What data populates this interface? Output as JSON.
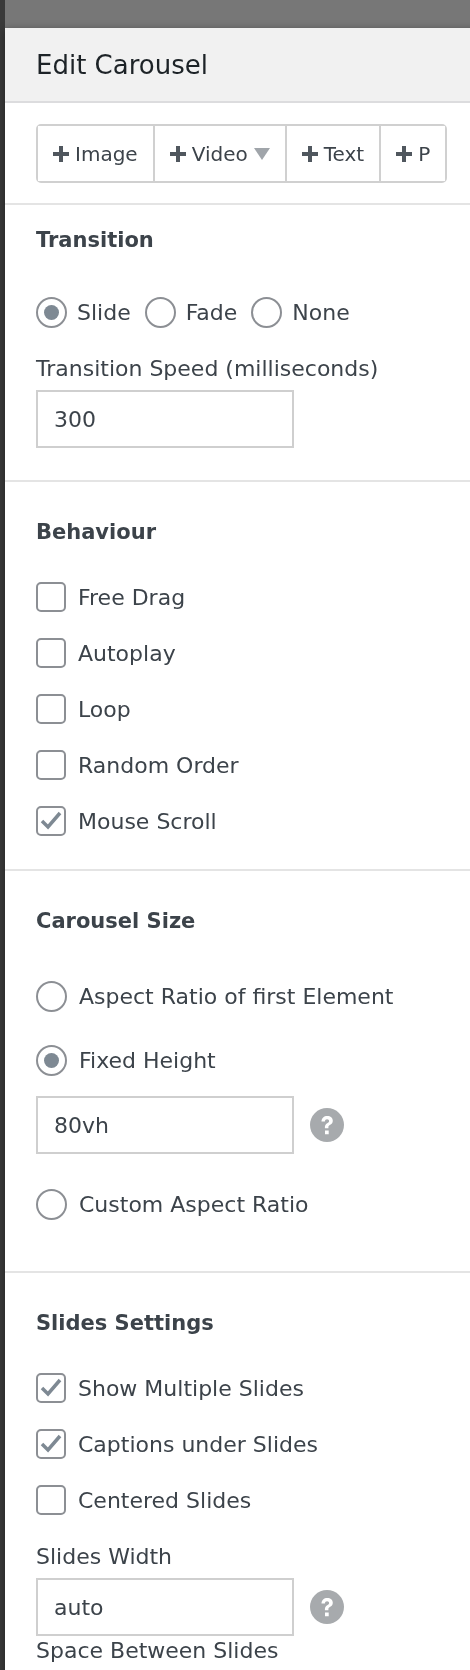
{
  "dialog": {
    "title": "Edit Carousel"
  },
  "toolbar": [
    {
      "label": "Image",
      "dropdown": false
    },
    {
      "label": "Video",
      "dropdown": true
    },
    {
      "label": "Text",
      "dropdown": false
    },
    {
      "label": "P",
      "dropdown": false
    }
  ],
  "sections": [
    {
      "heading": "Transition",
      "items": [
        {
          "kind": "radio_row",
          "options": [
            {
              "label": "Slide",
              "selected": true
            },
            {
              "label": "Fade",
              "selected": false
            },
            {
              "label": "None",
              "selected": false
            }
          ]
        },
        {
          "kind": "label",
          "text": "Transition Speed (milliseconds)"
        },
        {
          "kind": "field",
          "value": "300",
          "help": false
        }
      ]
    },
    {
      "heading": "Behaviour",
      "items": [
        {
          "kind": "checkbox",
          "label": "Free Drag",
          "checked": false
        },
        {
          "kind": "checkbox",
          "label": "Autoplay",
          "checked": false
        },
        {
          "kind": "checkbox",
          "label": "Loop",
          "checked": false
        },
        {
          "kind": "checkbox",
          "label": "Random Order",
          "checked": false
        },
        {
          "kind": "checkbox",
          "label": "Mouse Scroll",
          "checked": true
        }
      ]
    },
    {
      "heading": "Carousel Size",
      "items": [
        {
          "kind": "radio",
          "label": "Aspect Ratio of first Element",
          "selected": false
        },
        {
          "kind": "radio",
          "label": "Fixed Height",
          "selected": true
        },
        {
          "kind": "field",
          "value": "80vh",
          "help": true
        },
        {
          "kind": "radio",
          "label": "Custom Aspect Ratio",
          "selected": false
        }
      ]
    },
    {
      "heading": "Slides Settings",
      "items": [
        {
          "kind": "checkbox",
          "label": "Show Multiple Slides",
          "checked": true
        },
        {
          "kind": "checkbox",
          "label": "Captions under Slides",
          "checked": true
        },
        {
          "kind": "checkbox",
          "label": "Centered Slides",
          "checked": false
        },
        {
          "kind": "label",
          "text": "Slides Width"
        },
        {
          "kind": "field",
          "value": "auto",
          "help": true
        },
        {
          "kind": "label",
          "text": "Space Between Slides"
        }
      ]
    }
  ]
}
